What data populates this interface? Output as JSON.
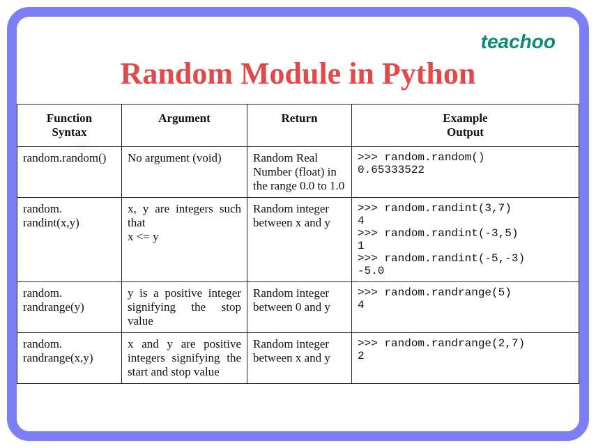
{
  "brand": "teachoo",
  "title": "Random Module in Python",
  "headers": {
    "syntax": "Function\nSyntax",
    "argument": "Argument",
    "return": "Return",
    "example": "Example\nOutput"
  },
  "rows": [
    {
      "syntax": "random.random()",
      "argument": "No argument (void)",
      "return": "Random Real Number (float) in the range 0.0 to 1.0",
      "example": ">>> random.random()\n0.65333522"
    },
    {
      "syntax": "random. randint(x,y)",
      "argument": "x, y are integers such that\nx <= y",
      "return": "Random integer between x and y",
      "example": ">>> random.randint(3,7)\n4\n>>> random.randint(-3,5)\n1\n>>> random.randint(-5,-3)\n-5.0"
    },
    {
      "syntax": "random. randrange(y)",
      "argument": "y is a positive integer signifying the stop value",
      "return": "Random integer between 0 and y",
      "example": ">>> random.randrange(5)\n4"
    },
    {
      "syntax": "random. randrange(x,y)",
      "argument": "x and y are positive integers signifying the start and stop value",
      "return": "Random integer between x and y",
      "example": ">>> random.randrange(2,7)\n2"
    }
  ]
}
